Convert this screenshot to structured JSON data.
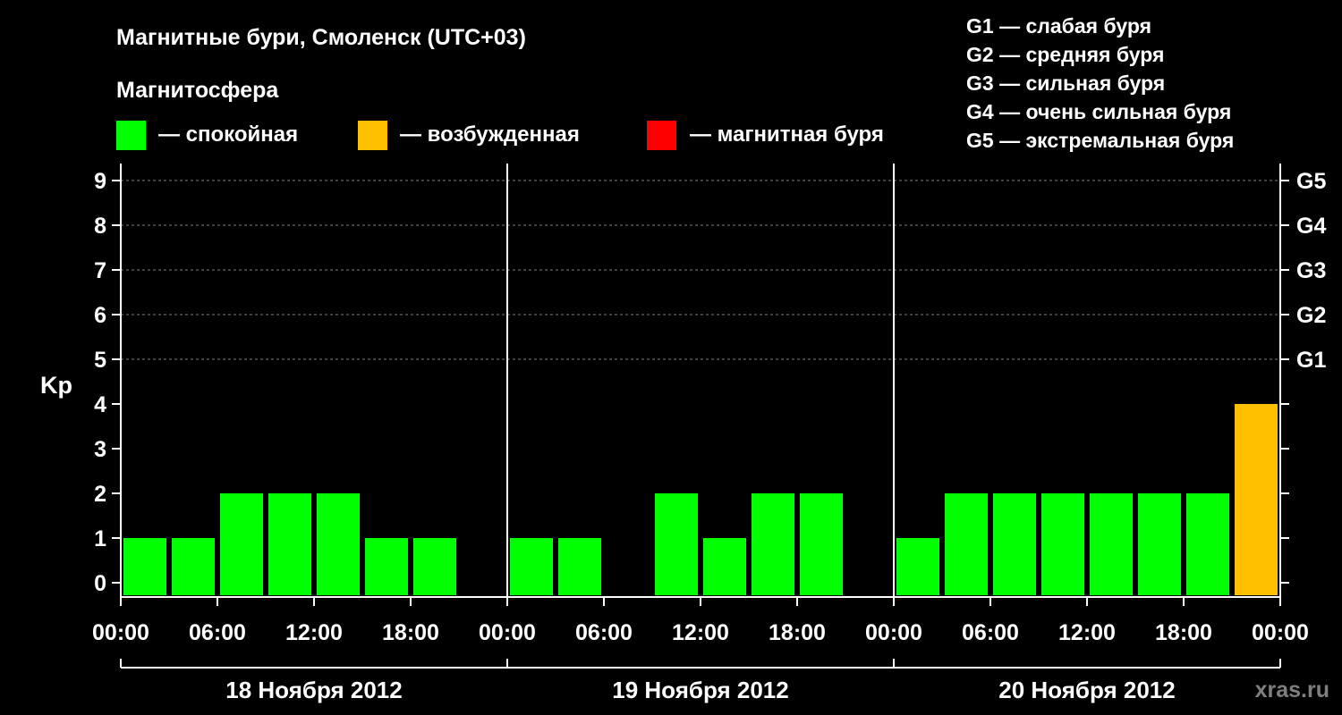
{
  "colors": {
    "background": "#000000",
    "calm": "#00ff00",
    "excited": "#ffc000",
    "storm": "#ff0000",
    "axis": "#ffffff",
    "grid": "#808080",
    "watermark": "#7f7f7f"
  },
  "header": {
    "title": "Магнитные бури, Смоленск (UTC+03)",
    "section_label": "Магнитосфера"
  },
  "legend": {
    "items": [
      {
        "key": "calm",
        "label": "— спокойная"
      },
      {
        "key": "excited",
        "label": "— возбужденная"
      },
      {
        "key": "storm",
        "label": "— магнитная буря"
      }
    ],
    "g_scale": [
      "G1 — слабая буря",
      "G2 — средняя буря",
      "G3 — сильная буря",
      "G4 — очень сильная буря",
      "G5 — экстремальная буря"
    ]
  },
  "watermark": "xras.ru",
  "chart_data": {
    "type": "bar",
    "ylabel": "Kp",
    "ylim": [
      0,
      9
    ],
    "yticks": [
      0,
      1,
      2,
      3,
      4,
      5,
      6,
      7,
      8,
      9
    ],
    "right_ticks": [
      {
        "value": 5,
        "label": "G1"
      },
      {
        "value": 6,
        "label": "G2"
      },
      {
        "value": 7,
        "label": "G3"
      },
      {
        "value": 8,
        "label": "G4"
      },
      {
        "value": 9,
        "label": "G5"
      }
    ],
    "grid": true,
    "days": [
      "18 Ноября 2012",
      "19 Ноября 2012",
      "20 Ноября 2012"
    ],
    "x_tick_labels": [
      "00:00",
      "06:00",
      "12:00",
      "18:00",
      "00:00",
      "06:00",
      "12:00",
      "18:00",
      "00:00",
      "06:00",
      "12:00",
      "18:00",
      "00:00"
    ],
    "interval_hours": 3,
    "series": [
      {
        "day": "18 Ноября 2012",
        "values": [
          1,
          1,
          2,
          2,
          2,
          1,
          1,
          0
        ],
        "levels": [
          "calm",
          "calm",
          "calm",
          "calm",
          "calm",
          "calm",
          "calm",
          "calm"
        ]
      },
      {
        "day": "19 Ноября 2012",
        "values": [
          1,
          1,
          0,
          2,
          1,
          2,
          2,
          0
        ],
        "levels": [
          "calm",
          "calm",
          "calm",
          "calm",
          "calm",
          "calm",
          "calm",
          "calm"
        ]
      },
      {
        "day": "20 Ноября 2012",
        "values": [
          1,
          2,
          2,
          2,
          2,
          2,
          2,
          4
        ],
        "levels": [
          "calm",
          "calm",
          "calm",
          "calm",
          "calm",
          "calm",
          "calm",
          "excited"
        ]
      }
    ]
  }
}
